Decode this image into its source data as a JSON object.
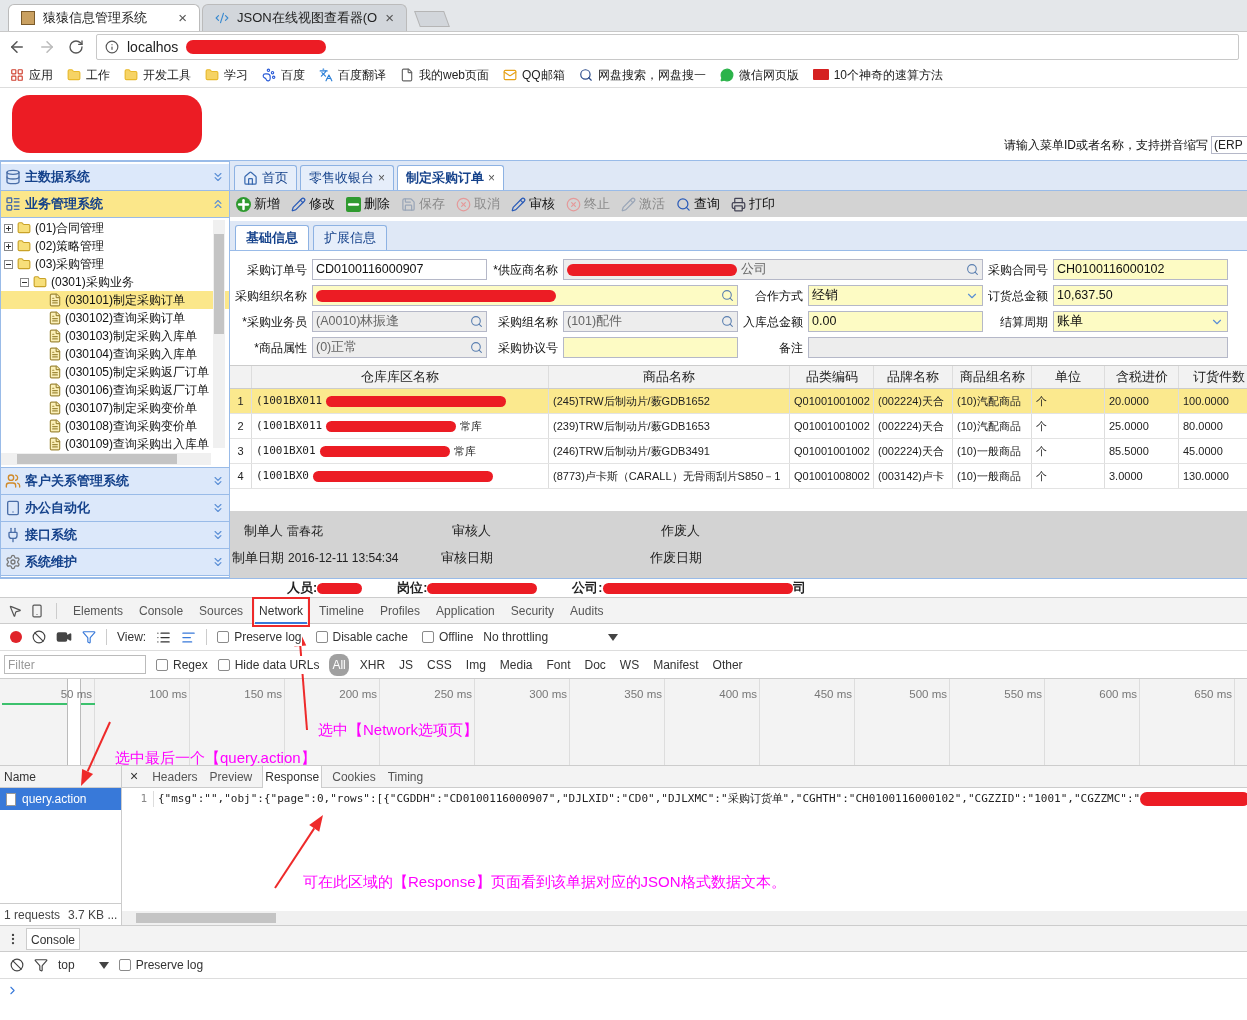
{
  "browser": {
    "tabs": [
      {
        "title": "猿猿信息管理系统",
        "close": "×",
        "selected": true
      },
      {
        "title": "JSON在线视图查看器(O",
        "close": "×",
        "selected": false
      }
    ],
    "address": "localhos",
    "bookmarks": [
      {
        "kind": "apps",
        "label": "应用"
      },
      {
        "kind": "folder",
        "label": "工作"
      },
      {
        "kind": "folder",
        "label": "开发工具"
      },
      {
        "kind": "folder",
        "label": "学习"
      },
      {
        "kind": "paw",
        "label": "百度"
      },
      {
        "kind": "translate",
        "label": "百度翻译"
      },
      {
        "kind": "page",
        "label": "我的web页面"
      },
      {
        "kind": "mail",
        "label": "QQ邮箱"
      },
      {
        "kind": "search",
        "label": "网盘搜索，网盘搜一"
      },
      {
        "kind": "chat",
        "label": "微信网页版"
      },
      {
        "kind": "badge",
        "label": "10个神奇的速算方法"
      }
    ]
  },
  "header": {
    "search_hint": "请输入菜单ID或者名称，支持拼音缩写",
    "search_value": "(ERP"
  },
  "sidebar": {
    "sections": [
      {
        "kind": "database",
        "label": "主数据系统",
        "expanded": false
      },
      {
        "kind": "business",
        "label": "业务管理系统",
        "expanded": true
      },
      {
        "kind": "customers",
        "label": "客户关系管理系统",
        "expanded": false
      },
      {
        "kind": "office",
        "label": "办公自动化",
        "expanded": false
      },
      {
        "kind": "interface",
        "label": "接口系统",
        "expanded": false
      },
      {
        "kind": "settings",
        "label": "系统维护",
        "expanded": false
      }
    ],
    "tree": [
      {
        "label": "(01)合同管理",
        "expanded": false,
        "selected": false
      },
      {
        "label": "(02)策略管理",
        "expanded": false,
        "selected": false
      },
      {
        "label": "(03)采购管理",
        "expanded": true,
        "selected": false,
        "children": [
          {
            "label": "(0301)采购业务",
            "expanded": true,
            "selected": false,
            "children": [
              {
                "label": "(030101)制定采购订单",
                "selected": true
              },
              {
                "label": "(030102)查询采购订单",
                "selected": false
              },
              {
                "label": "(030103)制定采购入库单",
                "selected": false
              },
              {
                "label": "(030104)查询采购入库单",
                "selected": false
              },
              {
                "label": "(030105)制定采购返厂订单",
                "selected": false
              },
              {
                "label": "(030106)查询采购返厂订单",
                "selected": false
              },
              {
                "label": "(030107)制定采购变价单",
                "selected": false
              },
              {
                "label": "(030108)查询采购变价单",
                "selected": false
              },
              {
                "label": "(030109)查询采购出入库单",
                "selected": false
              }
            ]
          }
        ]
      }
    ]
  },
  "page_tabs": [
    {
      "kind": "home",
      "label": "首页",
      "selected": false
    },
    {
      "kind": "page",
      "label": "零售收银台",
      "close": "×",
      "selected": false
    },
    {
      "kind": "page",
      "label": "制定采购订单",
      "close": "×",
      "selected": true
    }
  ],
  "toolbar": [
    {
      "kind": "add",
      "label": "新增",
      "disabled": false
    },
    {
      "kind": "edit",
      "label": "修改",
      "disabled": false
    },
    {
      "kind": "delete",
      "label": "删除",
      "disabled": false
    },
    {
      "kind": "save",
      "label": "保存",
      "disabled": true
    },
    {
      "kind": "cancel",
      "label": "取消",
      "disabled": true
    },
    {
      "kind": "edit",
      "label": "审核",
      "disabled": false
    },
    {
      "kind": "cancel",
      "label": "终止",
      "disabled": true
    },
    {
      "kind": "edit",
      "label": "激活",
      "disabled": true
    },
    {
      "kind": "search",
      "label": "查询",
      "disabled": false
    },
    {
      "kind": "print",
      "label": "打印",
      "disabled": false
    }
  ],
  "form_tabs": [
    {
      "label": "基础信息",
      "selected": true
    },
    {
      "label": "扩展信息",
      "selected": false
    }
  ],
  "form": [
    [
      {
        "label": "采购订单号",
        "kind": "text",
        "value": "CD0100116000907",
        "readonly": false,
        "highlighted": false
      },
      {
        "label": "*供应商名称",
        "kind": "lookup",
        "value": "公司",
        "redacted": true,
        "readonly": true,
        "highlighted": false
      },
      {
        "label": "采购合同号",
        "kind": "text",
        "value": "CH0100116000102",
        "readonly": false,
        "highlighted": true
      }
    ],
    [
      {
        "label": "采购组织名称",
        "kind": "lookup",
        "redacted": true,
        "readonly": false,
        "highlighted": true
      },
      {
        "label": "合作方式",
        "kind": "select",
        "value": "经销",
        "readonly": false,
        "highlighted": true
      },
      {
        "label": "订货总金额",
        "kind": "text",
        "value": "10,637.50",
        "readonly": false,
        "highlighted": true
      }
    ],
    [
      {
        "label": "*采购业务员",
        "kind": "lookup",
        "value": "(A0010)林振逢",
        "readonly": true,
        "highlighted": false
      },
      {
        "label": "采购组名称",
        "kind": "lookup",
        "value": "(101)配件",
        "readonly": true,
        "highlighted": false
      },
      {
        "label": "入库总金额",
        "kind": "text",
        "value": "0.00",
        "readonly": false,
        "highlighted": true
      },
      {
        "label": "结算周期",
        "kind": "select",
        "value": "账单",
        "readonly": false,
        "highlighted": true
      }
    ],
    [
      {
        "label": "*商品属性",
        "kind": "lookup",
        "value": "(0)正常",
        "readonly": true,
        "highlighted": false
      },
      {
        "label": "采购协议号",
        "kind": "text",
        "readonly": false,
        "highlighted": true
      },
      {
        "label": "备注",
        "kind": "text",
        "readonly": true,
        "highlighted": false
      }
    ]
  ],
  "table": {
    "columns": [
      "仓库库区名称",
      "商品名称",
      "品类编码",
      "品牌名称",
      "商品组名称",
      "单位",
      "含税进价",
      "订货件数"
    ],
    "rows": [
      {
        "index": "1",
        "selected": true,
        "cells": [
          "(1001BX011",
          "(245)TRW后制动片/薮GDB1652",
          "Q01001001002",
          "(002224)天合",
          "(10)汽配商品",
          "个",
          "20.0000",
          "100.0000"
        ]
      },
      {
        "index": "2",
        "selected": false,
        "warehouse_tail": "常库",
        "cells": [
          "(1001BX011",
          "(239)TRW后制动片/薮GDB1653",
          "Q01001001002",
          "(002224)天合",
          "(10)汽配商品",
          "个",
          "25.0000",
          "80.0000"
        ]
      },
      {
        "index": "3",
        "selected": false,
        "warehouse_tail": "常库",
        "cells": [
          "(1001BX01",
          "(246)TRW后制动片/薮GDB3491",
          "Q01001001002",
          "(002224)天合",
          "(10)一般商品",
          "个",
          "85.5000",
          "45.0000"
        ]
      },
      {
        "index": "4",
        "selected": false,
        "cells": [
          "(1001BX0",
          "(8773)卢卡斯（CARALL）无骨雨刮片S850－1",
          "Q01001008002",
          "(003142)卢卡",
          "(10)一般商品",
          "个",
          "3.0000",
          "130.0000"
        ]
      }
    ]
  },
  "footer": [
    [
      {
        "label": "制单人",
        "value": "雷春花"
      },
      {
        "label": "审核人"
      },
      {
        "label": "作废人"
      }
    ],
    [
      {
        "label": "制单日期",
        "value": "2016-12-11 13:54:34"
      },
      {
        "label": "审核日期"
      },
      {
        "label": "作废日期"
      }
    ]
  ],
  "status": [
    {
      "label": "人员:"
    },
    {
      "label": "岗位:"
    },
    {
      "label": "公司:",
      "tail": "司"
    }
  ],
  "devtools": {
    "tabs": [
      {
        "label": "Elements",
        "selected": false
      },
      {
        "label": "Console",
        "selected": false
      },
      {
        "label": "Sources",
        "selected": false
      },
      {
        "label": "Network",
        "selected": true
      },
      {
        "label": "Timeline",
        "selected": false
      },
      {
        "label": "Profiles",
        "selected": false
      },
      {
        "label": "Application",
        "selected": false
      },
      {
        "label": "Security",
        "selected": false
      },
      {
        "label": "Audits",
        "selected": false
      }
    ],
    "view_label": "View:",
    "options": [
      {
        "label": "Preserve log",
        "checked": false
      },
      {
        "label": "Disable cache",
        "checked": false
      },
      {
        "label": "Offline",
        "checked": false
      }
    ],
    "throttling": "No throttling",
    "filter_placeholder": "Filter",
    "filter_options": [
      {
        "label": "Regex",
        "checked": false
      },
      {
        "label": "Hide data URLs",
        "checked": false
      }
    ],
    "types": [
      {
        "label": "All",
        "selected": true
      },
      {
        "label": "XHR",
        "selected": false
      },
      {
        "label": "JS",
        "selected": false
      },
      {
        "label": "CSS",
        "selected": false
      },
      {
        "label": "Img",
        "selected": false
      },
      {
        "label": "Media",
        "selected": false
      },
      {
        "label": "Font",
        "selected": false
      },
      {
        "label": "Doc",
        "selected": false
      },
      {
        "label": "WS",
        "selected": false
      },
      {
        "label": "Manifest",
        "selected": false
      },
      {
        "label": "Other",
        "selected": false
      }
    ],
    "ticks": [
      "50 ms",
      "100 ms",
      "150 ms",
      "200 ms",
      "250 ms",
      "300 ms",
      "350 ms",
      "400 ms",
      "450 ms",
      "500 ms",
      "550 ms",
      "600 ms",
      "650 ms"
    ],
    "name_header": "Name",
    "requests": [
      {
        "name": "query.action",
        "selected": true
      }
    ],
    "summary": "1 requests",
    "size": "3.7 KB ...",
    "close": "×",
    "detail_tabs": [
      {
        "label": "Headers",
        "selected": false
      },
      {
        "label": "Preview",
        "selected": false
      },
      {
        "label": "Response",
        "selected": true
      },
      {
        "label": "Cookies",
        "selected": false
      },
      {
        "label": "Timing",
        "selected": false
      }
    ],
    "response_lines": [
      {
        "number": "1",
        "text": "{\"msg\":\"\",\"obj\":{\"page\":0,\"rows\":[{\"CGDDH\":\"CD0100116000907\",\"DJLXID\":\"CD0\",\"DJLXMC\":\"采购订货单\",\"CGHTH\":\"CH0100116000102\",\"CGZZID\":\"1001\",\"CGZZMC\":\""
      }
    ],
    "drawer_tab": "Console",
    "context": "top",
    "console_options": [
      {
        "label": "Preserve log",
        "checked": false
      }
    ]
  },
  "annotations": [
    {
      "text": "选中【Network选项页】"
    },
    {
      "text": "选中最后一个【query.action】"
    },
    {
      "text": "可在此区域的【Response】页面看到该单据对应的JSON格式数据文本。"
    }
  ]
}
